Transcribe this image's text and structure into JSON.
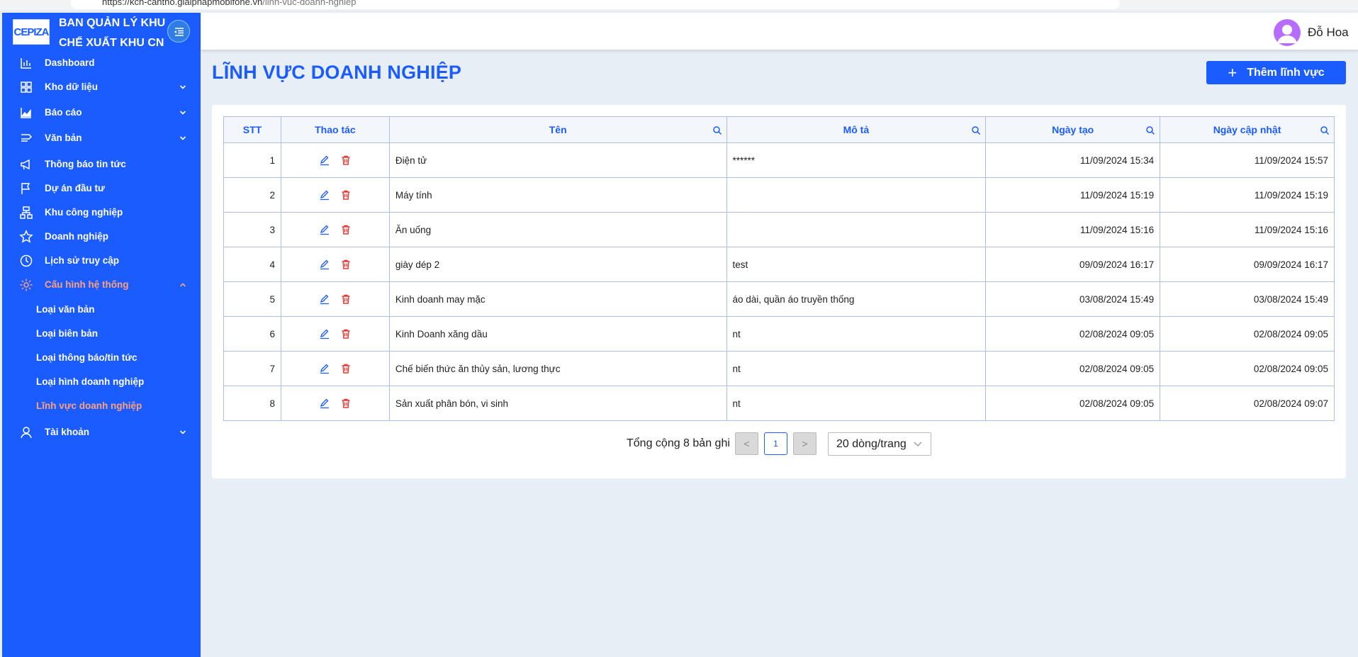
{
  "browser": {
    "url_host": "https://kcn-cantho.giaiphapmobifone.vn",
    "url_path": "/linh-vuc-doanh-nghiep"
  },
  "sidebar": {
    "logo": "CEPIZA",
    "brand": "BAN QUẢN LÝ KHU CHẾ XUẤT KHU CN",
    "items": [
      {
        "label": "Dashboard",
        "icon": "bar-chart-icon"
      },
      {
        "label": "Kho dữ liệu",
        "icon": "grid-icon",
        "expandable": true
      },
      {
        "label": "Báo cáo",
        "icon": "area-chart-icon",
        "expandable": true
      },
      {
        "label": "Văn bản",
        "icon": "document-arrow-icon",
        "expandable": true
      },
      {
        "label": "Thông báo tin tức",
        "icon": "megaphone-icon"
      },
      {
        "label": "Dự án đầu tư",
        "icon": "flag-icon"
      },
      {
        "label": "Khu công nghiệp",
        "icon": "cluster-icon"
      },
      {
        "label": "Doanh nghiệp",
        "icon": "star-icon"
      },
      {
        "label": "Lịch sử truy cập",
        "icon": "clock-icon"
      },
      {
        "label": "Cấu hình hệ thống",
        "icon": "gear-icon",
        "expanded": true
      }
    ],
    "sub_items": [
      {
        "label": "Loại văn bản"
      },
      {
        "label": "Loại biên bản"
      },
      {
        "label": "Loại thông báo/tin tức"
      },
      {
        "label": "Loại hình doanh nghiệp"
      },
      {
        "label": "Lĩnh vực doanh nghiệp",
        "active": true
      }
    ],
    "account": {
      "label": "Tài khoản",
      "icon": "user-icon"
    }
  },
  "header": {
    "username": "Đỗ Hoa"
  },
  "page": {
    "title": "LĨNH VỰC DOANH NGHIỆP",
    "add_button": "Thêm lĩnh vực"
  },
  "table": {
    "columns": [
      "STT",
      "Thao tác",
      "Tên",
      "Mô tả",
      "Ngày tạo",
      "Ngày cập nhật"
    ],
    "rows": [
      {
        "stt": "1",
        "ten": "Điện tử",
        "mota": "******",
        "ngay_tao": "11/09/2024 15:34",
        "ngay_cap_nhat": "11/09/2024 15:57"
      },
      {
        "stt": "2",
        "ten": "Máy tính",
        "mota": "",
        "ngay_tao": "11/09/2024 15:19",
        "ngay_cap_nhat": "11/09/2024 15:19"
      },
      {
        "stt": "3",
        "ten": "Ăn uống",
        "mota": "",
        "ngay_tao": "11/09/2024 15:16",
        "ngay_cap_nhat": "11/09/2024 15:16"
      },
      {
        "stt": "4",
        "ten": "giày dép 2",
        "mota": "test",
        "ngay_tao": "09/09/2024 16:17",
        "ngay_cap_nhat": "09/09/2024 16:17"
      },
      {
        "stt": "5",
        "ten": "Kinh doanh may mặc",
        "mota": "áo dài, quần áo truyền thống",
        "ngay_tao": "03/08/2024 15:49",
        "ngay_cap_nhat": "03/08/2024 15:49"
      },
      {
        "stt": "6",
        "ten": "Kinh Doanh xăng dầu",
        "mota": "nt",
        "ngay_tao": "02/08/2024 09:05",
        "ngay_cap_nhat": "02/08/2024 09:05"
      },
      {
        "stt": "7",
        "ten": "Chế biến thức ăn thủy sản, lương thực",
        "mota": "nt",
        "ngay_tao": "02/08/2024 09:05",
        "ngay_cap_nhat": "02/08/2024 09:05"
      },
      {
        "stt": "8",
        "ten": "Sản xuất phân bón, vi sinh",
        "mota": "nt",
        "ngay_tao": "02/08/2024 09:05",
        "ngay_cap_nhat": "02/08/2024 09:07"
      }
    ]
  },
  "pagination": {
    "total": "Tổng cộng 8 bản ghi",
    "current_page": "1",
    "prev": "<",
    "next": ">",
    "page_size": "20 dòng/trang"
  },
  "colors": {
    "primary": "#1a5cff",
    "active_menu": "#ffa178",
    "delete": "#e53935",
    "background": "#e8eef6"
  }
}
